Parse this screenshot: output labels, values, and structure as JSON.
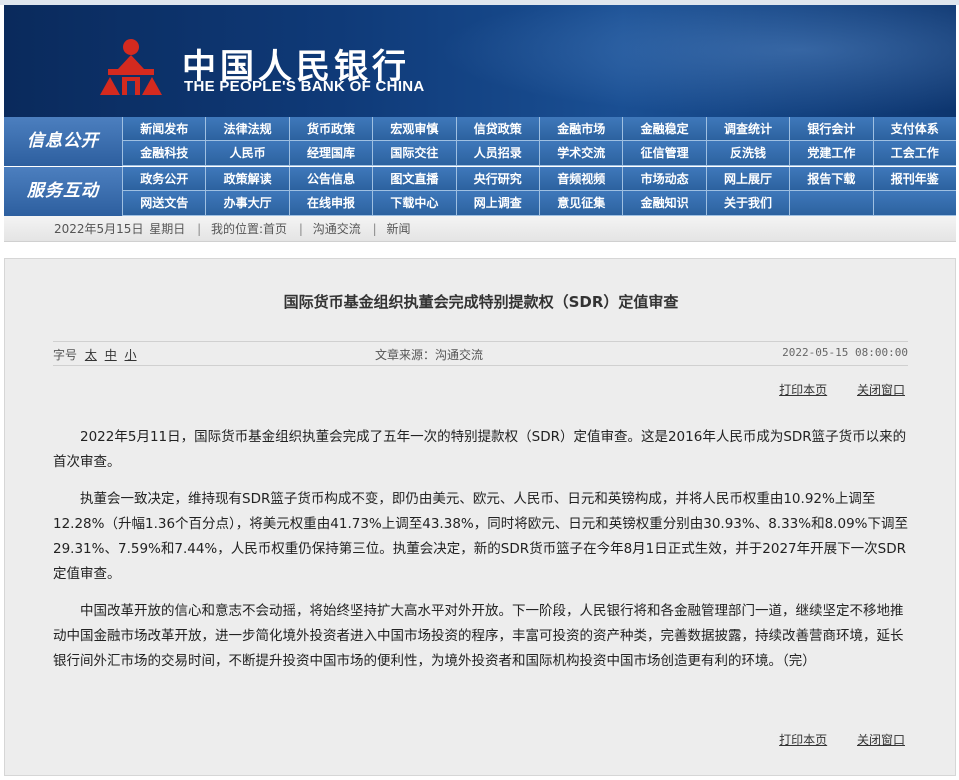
{
  "banner": {
    "logo_cn": "中国人民银行",
    "logo_en": "THE PEOPLE'S BANK OF CHINA",
    "colors": {
      "bg_dark": "#0a2a5c",
      "logo_red": "#d42a1f"
    }
  },
  "nav": {
    "row1": {
      "label": "信息公开",
      "items": [
        "新闻发布",
        "法律法规",
        "货币政策",
        "宏观审慎",
        "信贷政策",
        "金融市场",
        "金融稳定",
        "调查统计",
        "银行会计",
        "支付体系",
        "金融科技",
        "人民币",
        "经理国库",
        "国际交往",
        "人员招录",
        "学术交流",
        "征信管理",
        "反洗钱",
        "党建工作",
        "工会工作"
      ]
    },
    "row2": {
      "label": "服务互动",
      "items": [
        "政务公开",
        "政策解读",
        "公告信息",
        "图文直播",
        "央行研究",
        "音频视频",
        "市场动态",
        "网上展厅",
        "报告下载",
        "报刊年鉴",
        "网送文告",
        "办事大厅",
        "在线申报",
        "下载中心",
        "网上调查",
        "意见征集",
        "金融知识",
        "关于我们",
        "",
        ""
      ]
    }
  },
  "breadcrumb": {
    "date": "2022年5月15日",
    "weekday": "星期日",
    "location_label": "我的位置:首页",
    "level2": "沟通交流",
    "level3": "新闻"
  },
  "article": {
    "title": "国际货币基金组织执董会完成特别提款权（SDR）定值审查",
    "font_size_label": "字号",
    "font_sizes": [
      "太",
      "中",
      "小"
    ],
    "source": "文章来源：沟通交流",
    "datetime": "2022-05-15 08:00:00",
    "print_label": "打印本页",
    "close_label": "关闭窗口",
    "paragraphs": [
      "2022年5月11日，国际货币基金组织执董会完成了五年一次的特别提款权（SDR）定值审查。这是2016年人民币成为SDR篮子货币以来的首次审查。",
      "执董会一致决定，维持现有SDR篮子货币构成不变，即仍由美元、欧元、人民币、日元和英镑构成，并将人民币权重由10.92%上调至12.28%（升幅1.36个百分点），将美元权重由41.73%上调至43.38%，同时将欧元、日元和英镑权重分别由30.93%、8.33%和8.09%下调至29.31%、7.59%和7.44%，人民币权重仍保持第三位。执董会决定，新的SDR货币篮子在今年8月1日正式生效，并于2027年开展下一次SDR定值审查。",
      "中国改革开放的信心和意志不会动摇，将始终坚持扩大高水平对外开放。下一阶段，人民银行将和各金融管理部门一道，继续坚定不移地推动中国金融市场改革开放，进一步简化境外投资者进入中国市场投资的程序，丰富可投资的资产种类，完善数据披露，持续改善营商环境，延长银行间外汇市场的交易时间，不断提升投资中国市场的便利性，为境外投资者和国际机构投资中国市场创造更有利的环境。（完）"
    ]
  }
}
